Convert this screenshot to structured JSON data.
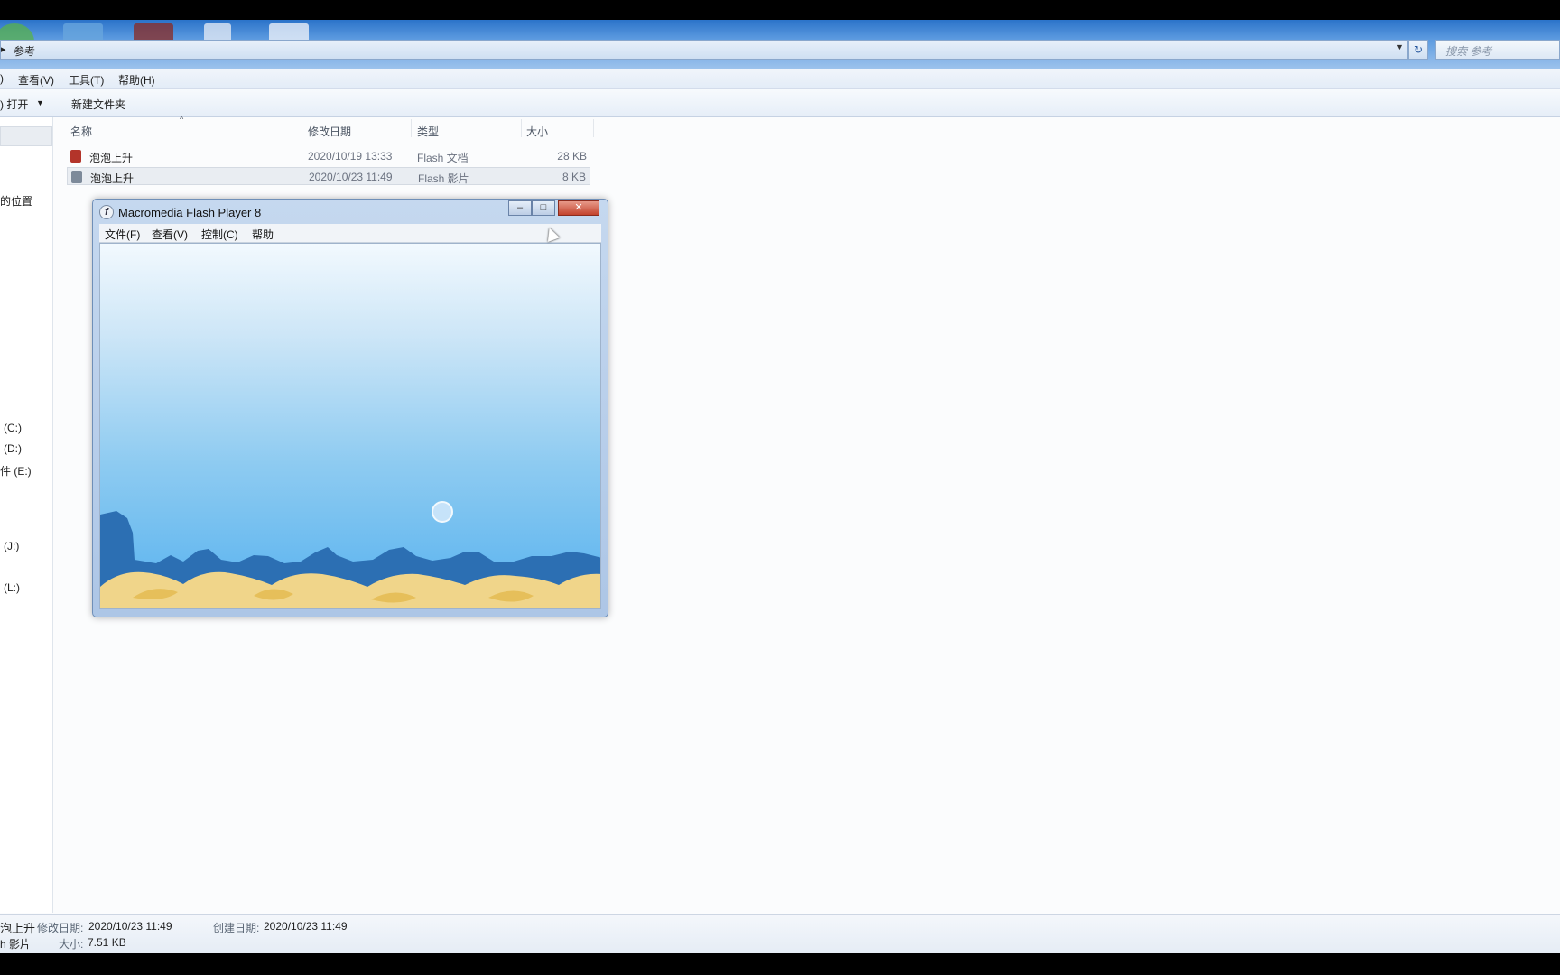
{
  "address": {
    "path": "参考",
    "search_placeholder": "搜索 参考"
  },
  "menubar": {
    "items": [
      ")",
      "查看(V)",
      "工具(T)",
      "帮助(H)"
    ]
  },
  "toolbar": {
    "open_label": ") 打开",
    "new_folder_label": "新建文件夹"
  },
  "nav": {
    "items": [
      "的位置",
      "(C:)",
      "(D:)",
      "件 (E:)",
      "(J:)",
      "(L:)"
    ]
  },
  "columns": {
    "name": "名称",
    "modified": "修改日期",
    "type": "类型",
    "size": "大小"
  },
  "files": [
    {
      "name": "泡泡上升",
      "modified": "2020/10/19 13:33",
      "type": "Flash 文档",
      "size": "28 KB",
      "icon": "flash-document-icon",
      "color": "#b3342a"
    },
    {
      "name": "泡泡上升",
      "modified": "2020/10/23 11:49",
      "type": "Flash 影片",
      "size": "8 KB",
      "icon": "flash-movie-icon",
      "color": "#7d8a9a"
    }
  ],
  "flash_player": {
    "title": "Macromedia Flash Player 8",
    "logo": "f",
    "menu": [
      "文件(F)",
      "查看(V)",
      "控制(C)",
      "帮助"
    ]
  },
  "status": {
    "name_fragment": "泡上升",
    "type_fragment": "h 影片",
    "modified_label": "修改日期:",
    "modified_value": "2020/10/23 11:49",
    "created_label": "创建日期:",
    "created_value": "2020/10/23 11:49",
    "size_label": "大小:",
    "size_value": "7.51 KB"
  },
  "colors": {
    "titlebar": "#2b73c9",
    "stage_top": "#f2f9fe",
    "stage_bottom": "#57b2ef",
    "sand": "#f0d58a"
  }
}
